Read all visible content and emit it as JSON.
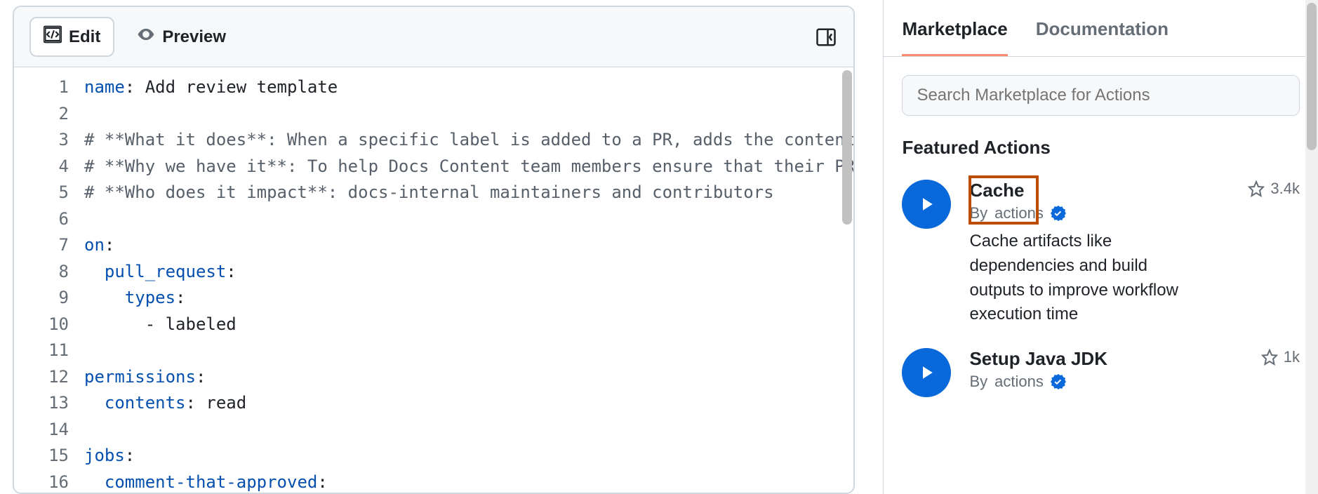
{
  "editor": {
    "tabs": {
      "edit": "Edit",
      "preview": "Preview"
    },
    "lines": [
      {
        "n": 1,
        "tokens": [
          [
            "key",
            "name"
          ],
          [
            "punct",
            ":"
          ],
          [
            "text",
            " Add review template"
          ]
        ]
      },
      {
        "n": 2,
        "tokens": []
      },
      {
        "n": 3,
        "tokens": [
          [
            "comment",
            "# **What it does**: When a specific label is added to a PR, adds the contents "
          ]
        ]
      },
      {
        "n": 4,
        "tokens": [
          [
            "comment",
            "# **Why we have it**: To help Docs Content team members ensure that their PR i"
          ]
        ]
      },
      {
        "n": 5,
        "tokens": [
          [
            "comment",
            "# **Who does it impact**: docs-internal maintainers and contributors"
          ]
        ]
      },
      {
        "n": 6,
        "tokens": []
      },
      {
        "n": 7,
        "tokens": [
          [
            "key",
            "on"
          ],
          [
            "punct",
            ":"
          ]
        ]
      },
      {
        "n": 8,
        "tokens": [
          [
            "text",
            "  "
          ],
          [
            "key",
            "pull_request"
          ],
          [
            "punct",
            ":"
          ]
        ]
      },
      {
        "n": 9,
        "tokens": [
          [
            "text",
            "    "
          ],
          [
            "key",
            "types"
          ],
          [
            "punct",
            ":"
          ]
        ]
      },
      {
        "n": 10,
        "tokens": [
          [
            "text",
            "      - labeled"
          ]
        ]
      },
      {
        "n": 11,
        "tokens": []
      },
      {
        "n": 12,
        "tokens": [
          [
            "key",
            "permissions"
          ],
          [
            "punct",
            ":"
          ]
        ]
      },
      {
        "n": 13,
        "tokens": [
          [
            "text",
            "  "
          ],
          [
            "key",
            "contents"
          ],
          [
            "punct",
            ":"
          ],
          [
            "text",
            " read"
          ]
        ]
      },
      {
        "n": 14,
        "tokens": []
      },
      {
        "n": 15,
        "tokens": [
          [
            "key",
            "jobs"
          ],
          [
            "punct",
            ":"
          ]
        ]
      },
      {
        "n": 16,
        "tokens": [
          [
            "text",
            "  "
          ],
          [
            "key",
            "comment-that-approved"
          ],
          [
            "punct",
            ":"
          ]
        ]
      }
    ]
  },
  "sidebar": {
    "tabs": {
      "marketplace": "Marketplace",
      "documentation": "Documentation"
    },
    "search_placeholder": "Search Marketplace for Actions",
    "section_title": "Featured Actions",
    "actions": [
      {
        "title": "Cache",
        "author_prefix": "By ",
        "author": "actions",
        "stars": "3.4k",
        "desc": "Cache artifacts like dependencies and build outputs to improve workflow execution time"
      },
      {
        "title": "Setup Java JDK",
        "author_prefix": "By ",
        "author": "actions",
        "stars": "1k",
        "desc": ""
      }
    ]
  }
}
